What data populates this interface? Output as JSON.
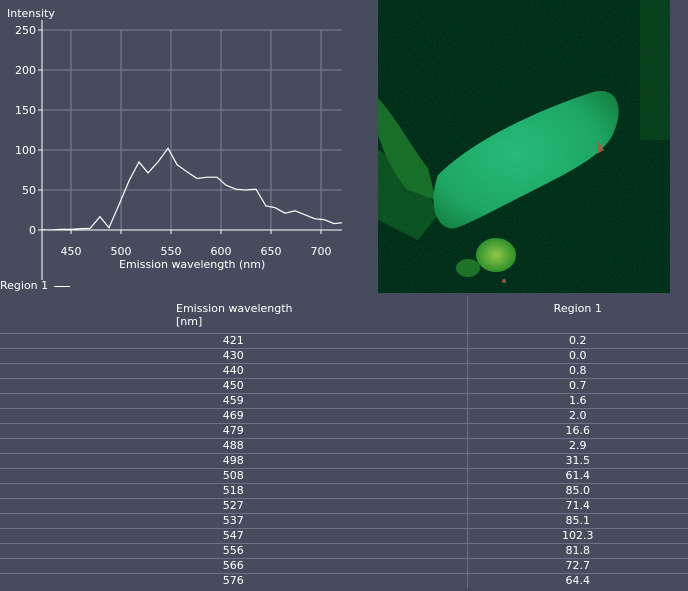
{
  "chart_data": {
    "type": "line",
    "y_axis_label": "Intensity",
    "x_axis_label": "Emission wavelength (nm)",
    "x_ticks": [
      450,
      500,
      550,
      600,
      650,
      700
    ],
    "y_ticks": [
      0,
      50,
      100,
      150,
      200,
      250
    ],
    "xlim": [
      421,
      721
    ],
    "ylim": [
      0,
      250
    ],
    "grid": true,
    "legend_placement": "bottom-left",
    "series": [
      {
        "name": "Region 1",
        "color": "#ffffff",
        "x": [
          421,
          430,
          440,
          450,
          459,
          469,
          479,
          488,
          498,
          508,
          518,
          527,
          537,
          547,
          556,
          566,
          576,
          586,
          596,
          605,
          615,
          625,
          635,
          645,
          654,
          664,
          674,
          684,
          694,
          703,
          713,
          721
        ],
        "y": [
          0.2,
          0.0,
          0.8,
          0.7,
          1.6,
          2.0,
          16.6,
          2.9,
          31.5,
          61.4,
          85.0,
          71.4,
          85.1,
          102.3,
          81.8,
          72.7,
          64.4,
          66,
          66,
          56,
          51,
          50,
          51,
          30,
          28,
          21,
          24,
          19,
          14,
          13,
          8,
          9
        ]
      }
    ]
  },
  "legend": {
    "label": "Region 1"
  },
  "table": {
    "header_col1_line1": "Emission wavelength",
    "header_col1_line2": "[nm]",
    "header_col2": "Region 1",
    "rows": [
      [
        "421",
        "0.2"
      ],
      [
        "430",
        "0.0"
      ],
      [
        "440",
        "0.8"
      ],
      [
        "450",
        "0.7"
      ],
      [
        "459",
        "1.6"
      ],
      [
        "469",
        "2.0"
      ],
      [
        "479",
        "16.6"
      ],
      [
        "488",
        "2.9"
      ],
      [
        "498",
        "31.5"
      ],
      [
        "508",
        "61.4"
      ],
      [
        "518",
        "85.0"
      ],
      [
        "527",
        "71.4"
      ],
      [
        "537",
        "85.1"
      ],
      [
        "547",
        "102.3"
      ],
      [
        "556",
        "81.8"
      ],
      [
        "566",
        "72.7"
      ],
      [
        "576",
        "64.4"
      ]
    ]
  },
  "colors": {
    "background": "#464c5e",
    "grid": "#7c8296",
    "line": "#ffffff",
    "micrograph_green": "#2fc07a"
  }
}
